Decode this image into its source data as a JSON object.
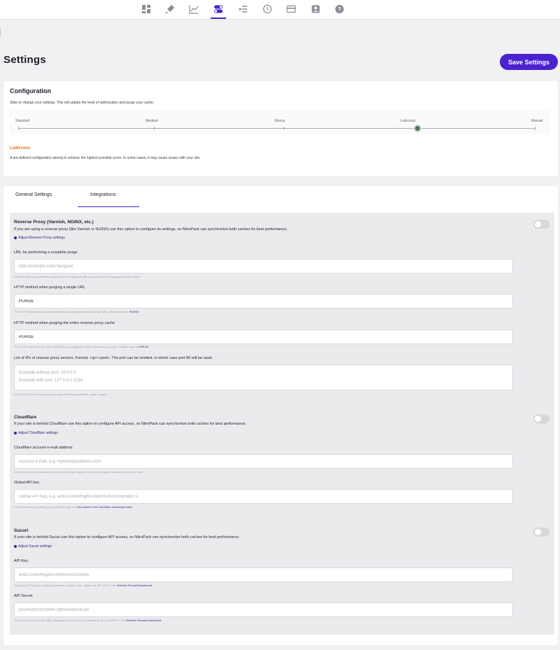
{
  "nav": {
    "icons": [
      "dashboard-icon",
      "plug-icon",
      "chart-icon",
      "toggles-icon",
      "add-list-icon",
      "history-icon",
      "card-icon",
      "user-icon",
      "help-icon"
    ],
    "active": "toggles-icon"
  },
  "page": {
    "title": "Settings",
    "save_label": "Save Settings"
  },
  "config": {
    "title": "Configuration",
    "description": "Slide to change your settings. This will update the level of optimization and purge your cache.",
    "levels": [
      "Standard",
      "Medium",
      "Strong",
      "Ludicrous",
      "Manual"
    ],
    "selected": "Ludicrous",
    "selected_description": "A pre-defined configuration aiming to achieve the highest possible score. In some cases, it may cause issues with your site."
  },
  "tabs": [
    "General Settings",
    "Integrations"
  ],
  "active_tab": "Integrations",
  "reverse_proxy": {
    "title": "Reverse Proxy (Varnish, NGINX, etc.)",
    "description": "If you are using a reverse proxy (like Varnish or NGINX) use this option to configure its settings, so NitroPack can synchronize both caches for best performance.",
    "link": "Adjust Reverse Proxy settings",
    "url_label": "URL for performing a complete purge",
    "url_placeholder": "http://example.com/?purgeAll",
    "url_help": "Use this only if your reverse proxy server is configured with a custom URL for purging its entire cache.",
    "single_label": "HTTP method when purging a single URL",
    "single_value": "PURGE",
    "single_help_prefix": "The HTTP method to use when NitroPack is purging cache for a single URL. Default value is",
    "single_help_value": "PURGE",
    "entire_label": "HTTP method when purging the entire reverse proxy cache",
    "entire_value": "PURGE",
    "entire_help_prefix": "The HTTP method to use when NitroPack is purging the entire reverse proxy cache. Default value is",
    "entire_help_value": "PURGE",
    "ips_label": "List of IPs of reverse proxy servers. Format: <ip>:<port>. The port can be omitted, in which case port 80 will be used.",
    "ips_placeholder": "Example without port: 10.0.0.5\nExample with port: 127.0.0.1:1234",
    "ips_help": "List the IPs of the reverse proxy servers that should get their cache purged."
  },
  "cloudflare": {
    "title": "Cloudflare",
    "description": "If your site is behind Cloudflare use this option to configure API access, so NitroPack can synchronize both caches for best performance.",
    "link": "Adjust Cloudflare settings",
    "email_label": "Cloudflare account e-mail address",
    "email_placeholder": "Account e-mail, e.g. myemail@address.com",
    "email_help": "Enter the primary email address for the Cloudflare account that controls https://resonance-et-dome.com/",
    "key_label": "Global API key",
    "key_placeholder": "Global API Key, e.g. a0b1c2d3e4f5g6h7i8j9k0l1m2n3o4p5q6r7s",
    "key_help_prefix": "For information on finding your global API key, see",
    "key_help_link": "this article in the Cloudflare knowledge base."
  },
  "sucuri": {
    "title": "Sucuri",
    "description": "If your site is behind Sucuri use this option to configure API access, so NitroPack can synchronize both caches for best performance.",
    "link": "Adjust Sucuri settings",
    "key_label": "API Key",
    "key_placeholder": "a0b1c2d3e4f5g6h7i8j9k0l1m2n3o4p5",
    "key_help_prefix": "The Sucuri API key for https://resonance-et-dome.com/, labeled as API_KEY in the",
    "key_help_link": "Website Firewall Dashboard",
    "secret_label": "API Secret",
    "secret_placeholder": "p5o4n3m2l1k0j9i8h7g6f5e4d3c2b1a0",
    "secret_help_prefix": "The Sucuri API secret for https://resonance-et-dome.com/, labeled as API_SECRET in the",
    "secret_help_link": "Website Firewall Dashboard"
  },
  "colors": {
    "accent": "#4b22d0",
    "ludicrous": "#e06b13",
    "link": "#2c2c80"
  }
}
